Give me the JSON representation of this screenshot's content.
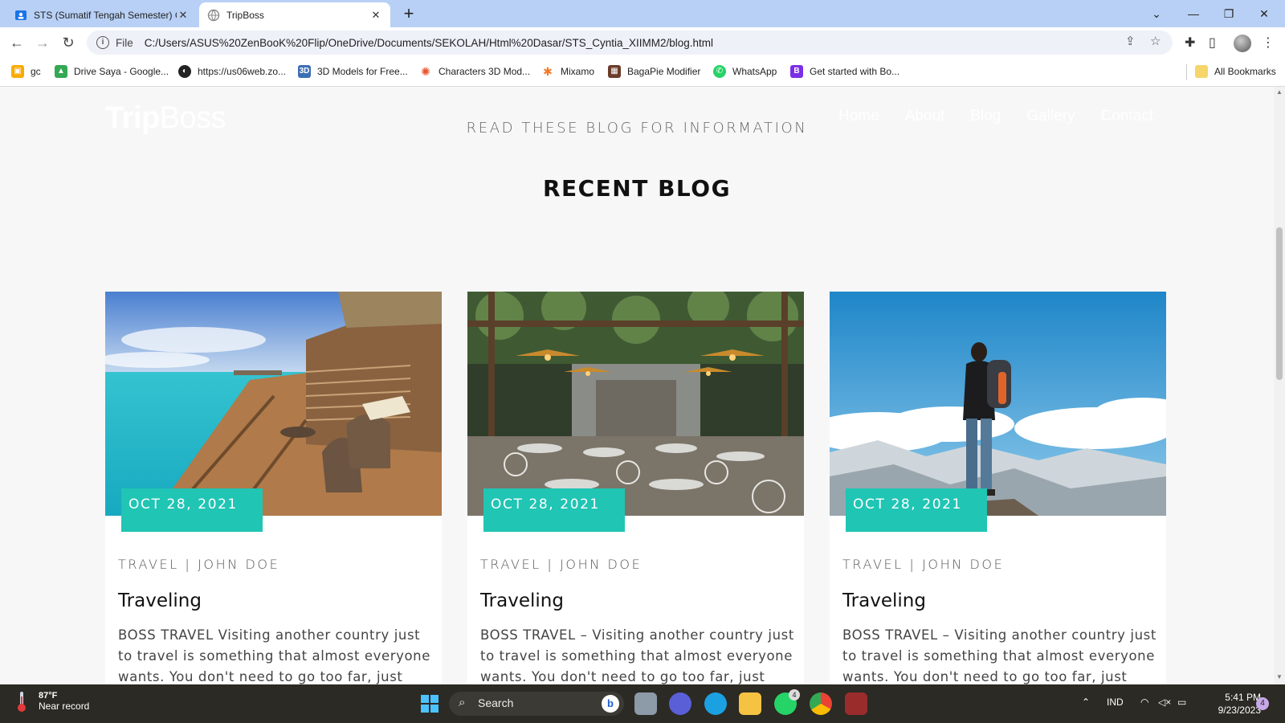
{
  "browser": {
    "tabs": [
      {
        "title": "STS (Sumatif Tengah Semester) C",
        "active": false
      },
      {
        "title": "TripBoss",
        "active": true
      }
    ],
    "address_scheme": "File",
    "address_url": "C:/Users/ASUS%20ZenBooK%20Flip/OneDrive/Documents/SEKOLAH/Html%20Dasar/STS_Cyntia_XIIMM2/blog.html",
    "bookmarks": [
      {
        "label": "gc",
        "icon": "classroom-icon",
        "color": "#f9ab00"
      },
      {
        "label": "Drive Saya - Google...",
        "icon": "drive-icon",
        "color": "#34a853"
      },
      {
        "label": "https://us06web.zo...",
        "icon": "globe-icon",
        "color": "#222222"
      },
      {
        "label": "3D Models for Free...",
        "icon": "3d-icon",
        "color": "#3d6fb5"
      },
      {
        "label": "Characters 3D Mod...",
        "icon": "mixamo-red-icon",
        "color": "#e8542a"
      },
      {
        "label": "Mixamo",
        "icon": "mixamo-icon",
        "color": "#f07b2a"
      },
      {
        "label": "BagaPie Modifier",
        "icon": "bagapie-icon",
        "color": "#6b3b2a"
      },
      {
        "label": "WhatsApp",
        "icon": "whatsapp-icon",
        "color": "#25d366"
      },
      {
        "label": "Get started with Bo...",
        "icon": "bootstrap-icon",
        "color": "#7b2fe6"
      }
    ],
    "all_bookmarks": "All Bookmarks"
  },
  "site": {
    "logo_part1": "Trip",
    "logo_part2": "Boss",
    "nav": [
      "Home",
      "About",
      "Blog",
      "Gallery",
      "Contact"
    ],
    "subtitle": "READ THESE BLOG FOR INFORMATION",
    "section_title": "RECENT BLOG",
    "accent_color": "#20c5b4",
    "cards": [
      {
        "image": "resort-balcony-photo",
        "date": "OCT 28, 2021",
        "meta": "TRAVEL | JOHN DOE",
        "title": "Traveling",
        "excerpt": "BOSS TRAVEL Visiting another country just to travel is something that almost everyone wants. You don't need to go too far, just"
      },
      {
        "image": "garden-restaurant-photo",
        "date": "OCT 28, 2021",
        "meta": "TRAVEL | JOHN DOE",
        "title": "Traveling",
        "excerpt": "BOSS TRAVEL – Visiting another country just to travel is something that almost everyone wants. You don't need to go too far, just"
      },
      {
        "image": "hiker-mountain-photo",
        "date": "OCT 28, 2021",
        "meta": "TRAVEL | JOHN DOE",
        "title": "Traveling",
        "excerpt": "BOSS TRAVEL – Visiting another country just to travel is something that almost everyone wants. You don't need to go too far, just"
      }
    ]
  },
  "taskbar": {
    "weather_temp": "87°F",
    "weather_desc": "Near record",
    "search_label": "Search",
    "language": "IND",
    "time": "5:41 PM",
    "date": "9/23/2023",
    "whatsapp_badge": "4",
    "notification_count": "4"
  }
}
